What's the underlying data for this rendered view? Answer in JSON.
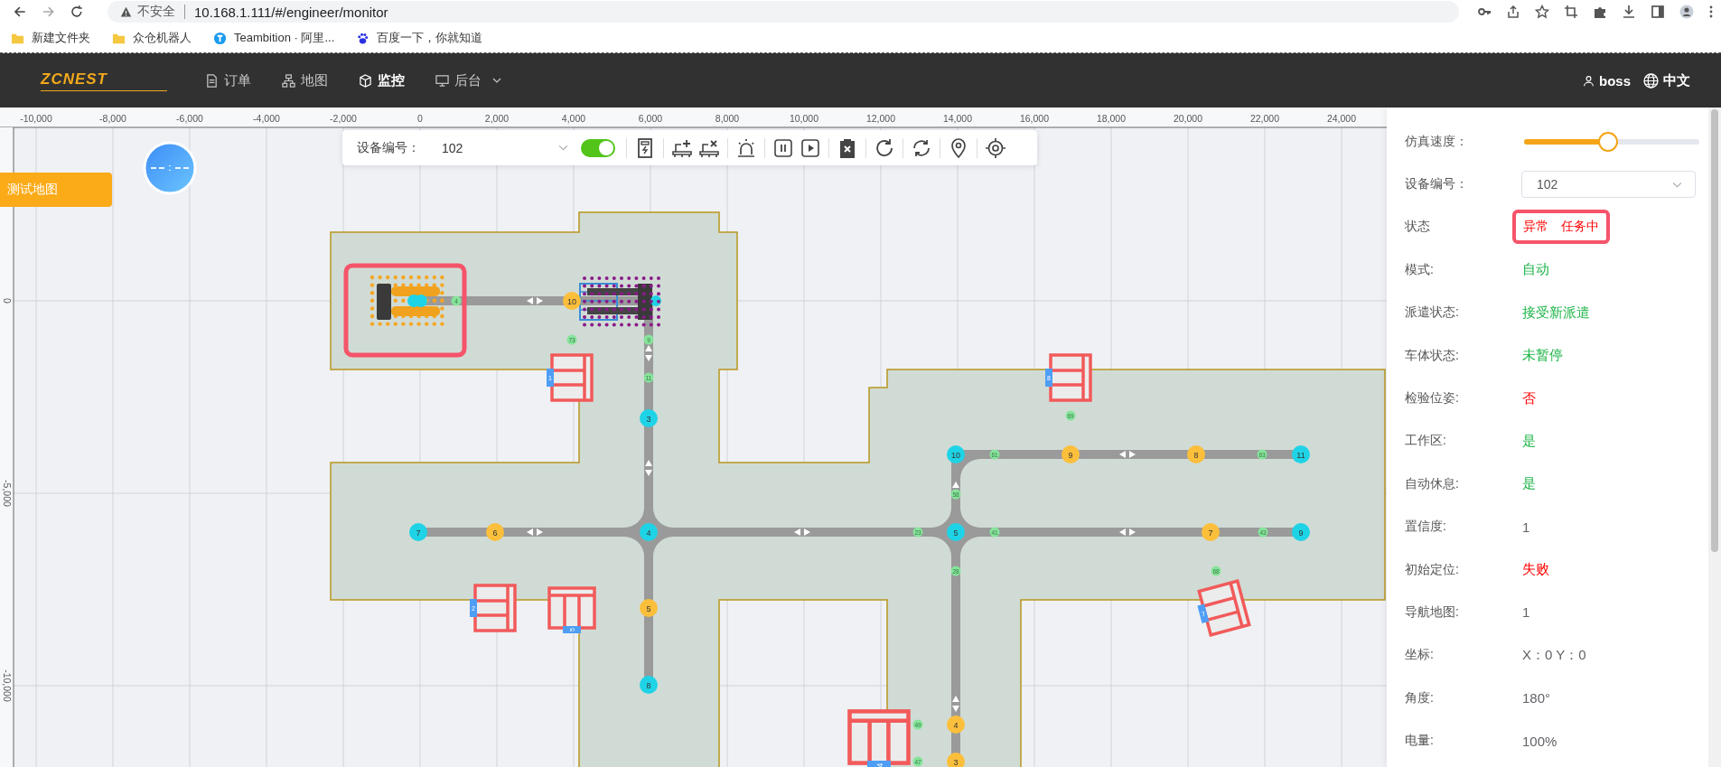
{
  "browser": {
    "security_label": "不安全",
    "url": "10.168.1.111/#/engineer/monitor"
  },
  "bookmarks": [
    {
      "label": "新建文件夹",
      "kind": "folder"
    },
    {
      "label": "众仓机器人",
      "kind": "folder"
    },
    {
      "label": "Teambition · 阿里...",
      "kind": "teambition"
    },
    {
      "label": "百度一下，你就知道",
      "kind": "baidu"
    }
  ],
  "header": {
    "logo": "ZCNEST",
    "nav": [
      {
        "label": "订单",
        "kind": "document",
        "selected": false
      },
      {
        "label": "地图",
        "kind": "sitemap",
        "selected": false
      },
      {
        "label": "监控",
        "kind": "cube",
        "selected": true
      },
      {
        "label": "后台",
        "kind": "monitor",
        "selected": false,
        "dropdown": true
      }
    ],
    "user": "boss",
    "language": "中文"
  },
  "toolbar": {
    "device_label": "设备编号：",
    "device_value": "102",
    "switch": {
      "on": true
    }
  },
  "map": {
    "name_tab": "测试地图",
    "x_ruler": [
      "-10,000",
      "-8,000",
      "-6,000",
      "-4,000",
      "-2,000",
      "0",
      "2,000",
      "4,000",
      "6,000",
      "8,000",
      "10,000",
      "12,000",
      "14,000",
      "16,000",
      "18,000",
      "20,000",
      "22,000",
      "24,000"
    ],
    "y_ruler": [
      "0",
      "-5,000",
      "-10,000"
    ],
    "nodes": [
      {
        "label": "10",
        "color": "#fbbf3c"
      },
      {
        "label": "3",
        "color": "#1fd3e6"
      },
      {
        "label": "10",
        "color": "#1fd3e6"
      },
      {
        "label": "9",
        "color": "#fbbf3c"
      },
      {
        "label": "8",
        "color": "#fbbf3c"
      },
      {
        "label": "11",
        "color": "#1fd3e6"
      },
      {
        "label": "7",
        "color": "#1fd3e6"
      },
      {
        "label": "6",
        "color": "#fbbf3c"
      },
      {
        "label": "4",
        "color": "#1fd3e6"
      },
      {
        "label": "5",
        "color": "#1fd3e6"
      },
      {
        "label": "7",
        "color": "#fbbf3c"
      },
      {
        "label": "9",
        "color": "#1fd3e6"
      },
      {
        "label": "5",
        "color": "#fbbf3c"
      },
      {
        "label": "8",
        "color": "#1fd3e6"
      },
      {
        "label": "4",
        "color": "#fbbf3c"
      },
      {
        "label": "3",
        "color": "#fbbf3c"
      }
    ],
    "markers": [
      {
        "label": "4"
      },
      {
        "label": "73"
      },
      {
        "label": "9"
      },
      {
        "label": "11"
      },
      {
        "label": "69"
      },
      {
        "label": "61"
      },
      {
        "label": "63"
      },
      {
        "label": "58"
      },
      {
        "label": "23"
      },
      {
        "label": "41"
      },
      {
        "label": "43"
      },
      {
        "label": "28"
      },
      {
        "label": "68"
      },
      {
        "label": "49"
      },
      {
        "label": "47"
      }
    ],
    "shelves": [
      {
        "label": "1"
      },
      {
        "label": "8"
      },
      {
        "label": "2"
      },
      {
        "label": "5"
      },
      {
        "label": "7"
      },
      {
        "label": "4"
      }
    ]
  },
  "panel": {
    "speed_label": "仿真速度：",
    "speed": {
      "level": 0.45
    },
    "device_label": "设备编号：",
    "device_value": "102",
    "status_label": "状态",
    "status": [
      "异常",
      "任务中"
    ],
    "rows": [
      {
        "label": "模式:",
        "value": "自动",
        "color": "#1cb447"
      },
      {
        "label": "派遣状态:",
        "value": "接受新派遣",
        "color": "#1cb447"
      },
      {
        "label": "车体状态:",
        "value": "未暂停",
        "color": "#1cb447"
      },
      {
        "label": "检验位姿:",
        "value": "否",
        "color": "#ff0000"
      },
      {
        "label": "工作区:",
        "value": "是",
        "color": "#1cb447"
      },
      {
        "label": "自动休息:",
        "value": "是",
        "color": "#1cb447"
      },
      {
        "label": "置信度:",
        "value": "1",
        "color": "#606266"
      },
      {
        "label": "初始定位:",
        "value": "失败",
        "color": "#ff0000"
      },
      {
        "label": "导航地图:",
        "value": "1",
        "color": "#606266"
      },
      {
        "label": "坐标:",
        "value": "X：0 Y：0",
        "color": "#606266"
      },
      {
        "label": "角度:",
        "value": "180°",
        "color": "#606266"
      },
      {
        "label": "电量:",
        "value": "100%",
        "color": "#606266"
      }
    ]
  }
}
